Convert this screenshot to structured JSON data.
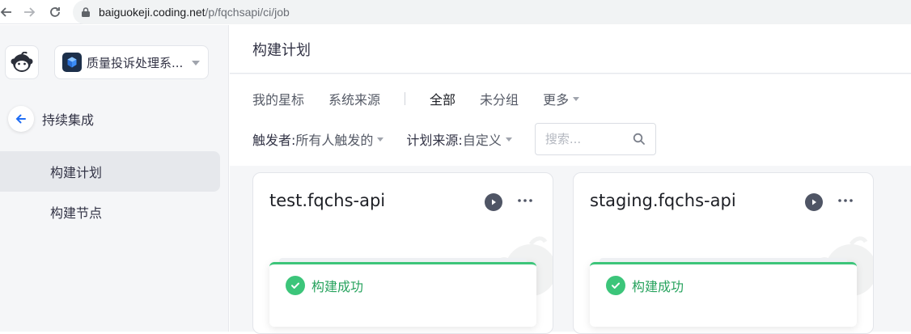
{
  "browser": {
    "url_host": "baiguokeji.coding.net",
    "url_path": "/p/fqchsapi/ci/job"
  },
  "sidebar": {
    "project_name": "质量投诉处理系...",
    "back_label": "持续集成",
    "items": [
      {
        "label": "构建计划",
        "active": true
      },
      {
        "label": "构建节点",
        "active": false
      }
    ]
  },
  "header": {
    "title": "构建计划"
  },
  "tabs": [
    {
      "label": "我的星标"
    },
    {
      "label": "系统来源"
    },
    {
      "label": "全部",
      "active": true
    },
    {
      "label": "未分组"
    },
    {
      "label": "更多"
    }
  ],
  "filters": {
    "trigger_label": "触发者:",
    "trigger_value": "所有人触发的",
    "source_label": "计划来源:",
    "source_value": "自定义",
    "search_placeholder": "搜索..."
  },
  "jobs": [
    {
      "name": "test.fqchs-api",
      "status": "构建成功"
    },
    {
      "name": "staging.fqchs-api",
      "status": "构建成功"
    }
  ],
  "colors": {
    "success": "#3cc57a",
    "accent": "#1f6df5"
  }
}
